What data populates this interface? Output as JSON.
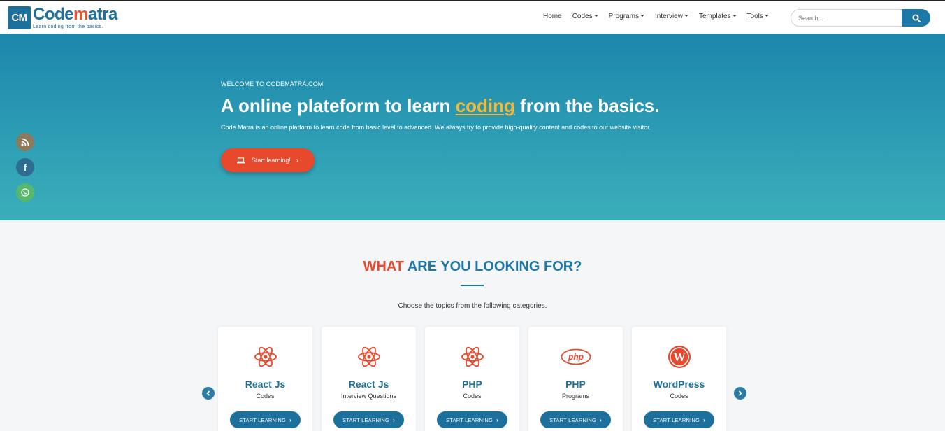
{
  "brand": {
    "badge": "CM",
    "word_part1": "Code",
    "word_part2": "m",
    "word_part3": "atra",
    "tagline": "Learn coding from the basics."
  },
  "nav": {
    "items": [
      {
        "label": "Home",
        "dropdown": false
      },
      {
        "label": "Codes",
        "dropdown": true
      },
      {
        "label": "Programs",
        "dropdown": true
      },
      {
        "label": "Interview",
        "dropdown": true
      },
      {
        "label": "Templates",
        "dropdown": true
      },
      {
        "label": "Tools",
        "dropdown": true
      }
    ],
    "search_placeholder": "Search..."
  },
  "hero": {
    "kicker": "WELCOME TO CODEMATRA.COM",
    "title_before": "A online plateform to learn ",
    "title_highlight": "coding",
    "title_after": " from the basics.",
    "description": "Code Matra is an online platform to learn code from basic level to advanced. We always try to provide high-quality content and codes to our website visitor.",
    "button_label": "Start learning!"
  },
  "social": [
    "rss-icon",
    "facebook-icon",
    "whatsapp-icon"
  ],
  "section": {
    "title_part1": "WHAT",
    "title_part2": " ARE YOU LOOKING FOR?",
    "subtitle": "Choose the topics from the following categories."
  },
  "cards": [
    {
      "title": "React Js",
      "subtitle": "Codes",
      "icon": "react-icon",
      "button": "START LEARNING"
    },
    {
      "title": "React Js",
      "subtitle": "Interview Questions",
      "icon": "react-icon",
      "button": "START LEARNING"
    },
    {
      "title": "PHP",
      "subtitle": "Codes",
      "icon": "react-icon",
      "button": "START LEARNING"
    },
    {
      "title": "PHP",
      "subtitle": "Programs",
      "icon": "php-icon",
      "button": "START LEARNING"
    },
    {
      "title": "WordPress",
      "subtitle": "Codes",
      "icon": "wordpress-icon",
      "button": "START LEARNING"
    }
  ],
  "colors": {
    "primary": "#1d6f9c",
    "accent": "#e8482c",
    "highlight": "#f1b935"
  }
}
